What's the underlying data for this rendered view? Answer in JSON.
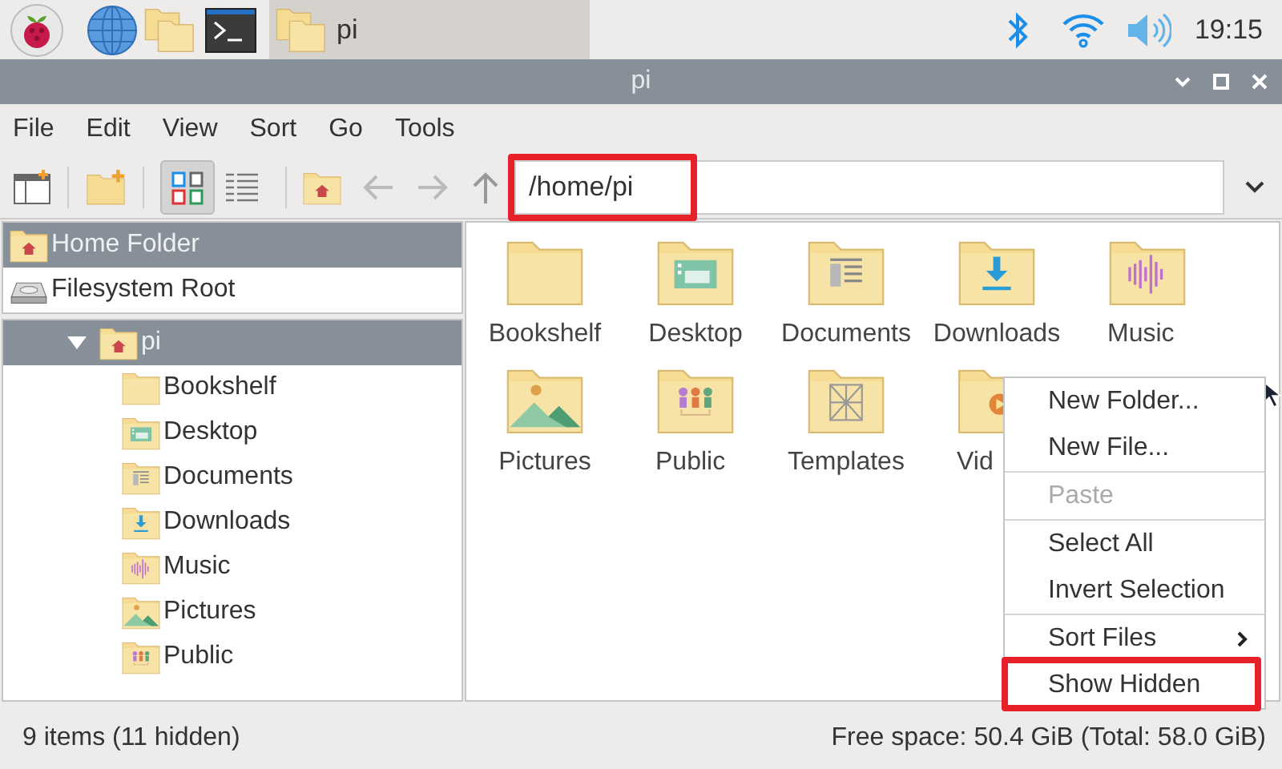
{
  "taskbar": {
    "window_button": {
      "label": "pi",
      "selected": true
    },
    "clock": "19:15"
  },
  "window": {
    "title": "pi"
  },
  "menu_bar": [
    "File",
    "Edit",
    "View",
    "Sort",
    "Go",
    "Tools"
  ],
  "toolbar": {
    "view_modes": [
      {
        "kind": "icons",
        "selected": true
      },
      {
        "kind": "list",
        "selected": false
      }
    ],
    "path_field": {
      "value": "/home/pi",
      "highlighted": true
    }
  },
  "places": [
    {
      "label": "Home Folder",
      "kind": "home",
      "selected": true
    },
    {
      "label": "Filesystem Root",
      "kind": "drive",
      "selected": false
    }
  ],
  "tree": [
    {
      "label": "pi",
      "kind": "home",
      "expanded": true,
      "selected": true,
      "children": [
        {
          "label": "Bookshelf",
          "kind": "plain"
        },
        {
          "label": "Desktop",
          "kind": "desktop"
        },
        {
          "label": "Documents",
          "kind": "documents"
        },
        {
          "label": "Downloads",
          "kind": "downloads"
        },
        {
          "label": "Music",
          "kind": "music"
        },
        {
          "label": "Pictures",
          "kind": "pictures"
        },
        {
          "label": "Public",
          "kind": "public"
        }
      ]
    }
  ],
  "files": [
    {
      "label": "Bookshelf",
      "kind": "plain"
    },
    {
      "label": "Desktop",
      "kind": "desktop"
    },
    {
      "label": "Documents",
      "kind": "documents"
    },
    {
      "label": "Downloads",
      "kind": "downloads"
    },
    {
      "label": "Music",
      "kind": "music"
    },
    {
      "label": "Pictures",
      "kind": "pictures"
    },
    {
      "label": "Public",
      "kind": "public"
    },
    {
      "label": "Templates",
      "kind": "templates"
    },
    {
      "label": "Vid",
      "kind": "videos"
    }
  ],
  "context_menu": [
    {
      "label": "New Folder...",
      "kind": "item",
      "disabled": false,
      "highlighted": false
    },
    {
      "label": "New File...",
      "kind": "item",
      "disabled": false,
      "highlighted": false
    },
    {
      "kind": "separator"
    },
    {
      "label": "Paste",
      "kind": "item",
      "disabled": true,
      "highlighted": false
    },
    {
      "kind": "separator"
    },
    {
      "label": "Select All",
      "kind": "item",
      "disabled": false,
      "highlighted": false
    },
    {
      "label": "Invert Selection",
      "kind": "item",
      "disabled": false,
      "highlighted": false
    },
    {
      "kind": "separator"
    },
    {
      "label": "Sort Files",
      "kind": "submenu",
      "disabled": false,
      "highlighted": false
    },
    {
      "label": "Show Hidden",
      "kind": "item",
      "disabled": false,
      "highlighted": true
    }
  ],
  "status_bar": {
    "left": "9 items (11 hidden)",
    "right": "Free space: 50.4 GiB (Total: 58.0 GiB)"
  }
}
